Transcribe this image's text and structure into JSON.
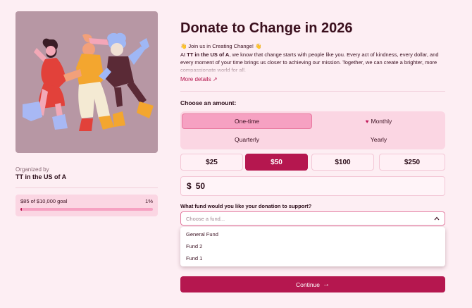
{
  "campaign": {
    "title": "Donate to Change in 2026",
    "intro_line": "👋 Join us in Creating Change! 👋",
    "intro_prefix": "At ",
    "intro_org": "TT in the US of A",
    "intro_rest": ", we know that change starts with people like you. Every act of kindness, every dollar, and every moment of your time brings us closer to achieving our mission. Together, we can create a brighter, more compassionate world for all.",
    "more_details": "More details"
  },
  "organizer": {
    "label": "Organized by",
    "name": "TT in the US of A"
  },
  "goal": {
    "text": "$85 of $10,000 goal",
    "percent_label": "1%",
    "progress": 0.01
  },
  "amount_section": {
    "label": "Choose an amount:",
    "frequency": {
      "one_time": "One-time",
      "monthly": "Monthly",
      "quarterly": "Quarterly",
      "yearly": "Yearly",
      "selected": "One-time"
    },
    "presets": [
      "$25",
      "$50",
      "$100",
      "$250"
    ],
    "selected_preset": "$50",
    "currency": "$",
    "amount_value": "50"
  },
  "fund": {
    "question": "What fund would you like your donation to support?",
    "placeholder": "Choose a fund...",
    "options": [
      "General Fund",
      "Fund 2",
      "Fund 1"
    ]
  },
  "continue_label": "Continue",
  "colors": {
    "accent": "#b5174f",
    "background": "#fdeef3",
    "accent_light": "#f6a1c2"
  }
}
